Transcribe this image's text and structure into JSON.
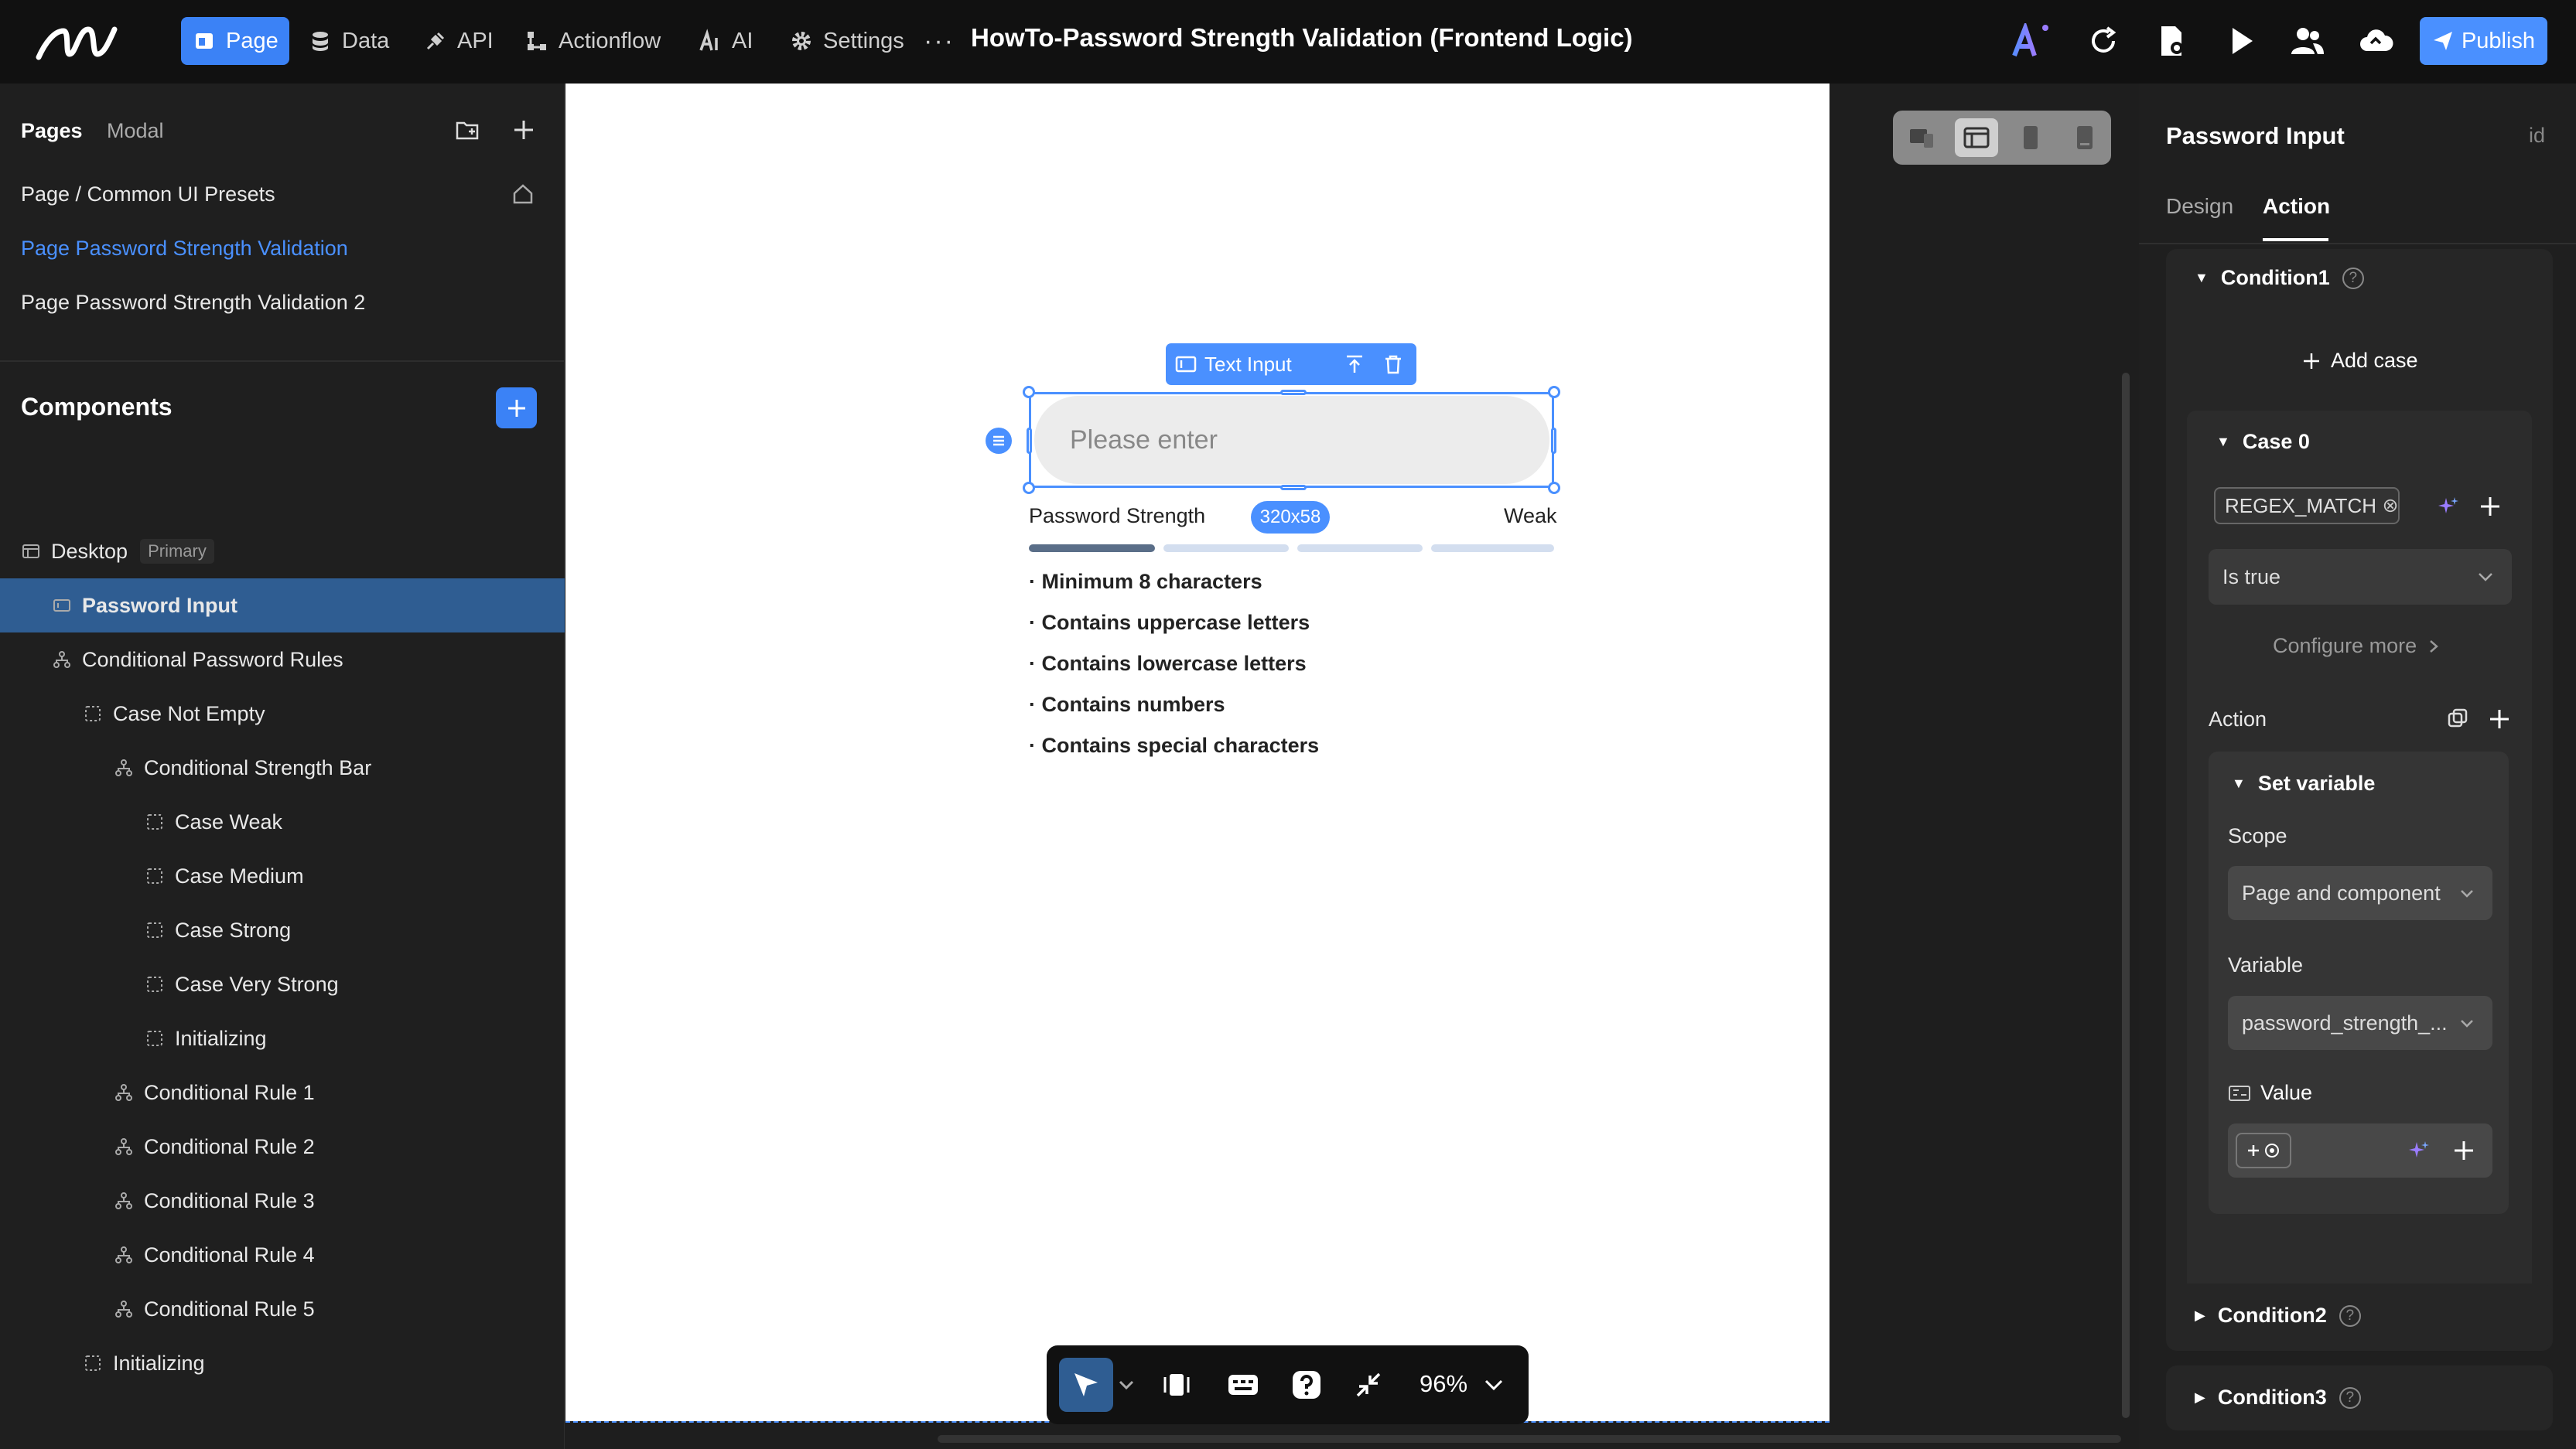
{
  "topbar": {
    "nav": [
      {
        "label": "Page",
        "icon": "page-icon"
      },
      {
        "label": "Data",
        "icon": "database-icon"
      },
      {
        "label": "API",
        "icon": "plug-icon"
      },
      {
        "label": "Actionflow",
        "icon": "flow-icon"
      },
      {
        "label": "AI",
        "icon": "ai-icon"
      },
      {
        "label": "Settings",
        "icon": "gear-icon"
      }
    ],
    "more": "···",
    "title": "HowTo-Password Strength Validation (Frontend Logic)",
    "publish": "Publish"
  },
  "left": {
    "tabs": [
      "Pages",
      "Modal"
    ],
    "pages": [
      "Page / Common UI Presets",
      "Page Password Strength Validation",
      "Page Password Strength Validation 2"
    ],
    "components_title": "Components",
    "tree": [
      {
        "label": "Desktop",
        "badge": "Primary",
        "indent": 0,
        "icon": "frame"
      },
      {
        "label": "Password Input",
        "indent": 1,
        "icon": "input",
        "selected": true
      },
      {
        "label": "Conditional Password Rules",
        "indent": 1,
        "icon": "cond"
      },
      {
        "label": "Case Not Empty",
        "indent": 2,
        "icon": "case"
      },
      {
        "label": "Conditional Strength Bar",
        "indent": 3,
        "icon": "cond"
      },
      {
        "label": "Case Weak",
        "indent": 4,
        "icon": "case"
      },
      {
        "label": "Case Medium",
        "indent": 4,
        "icon": "case"
      },
      {
        "label": "Case Strong",
        "indent": 4,
        "icon": "case"
      },
      {
        "label": "Case Very Strong",
        "indent": 4,
        "icon": "case"
      },
      {
        "label": "Initializing",
        "indent": 4,
        "icon": "case"
      },
      {
        "label": "Conditional Rule 1",
        "indent": 3,
        "icon": "cond"
      },
      {
        "label": "Conditional Rule 2",
        "indent": 3,
        "icon": "cond"
      },
      {
        "label": "Conditional Rule 3",
        "indent": 3,
        "icon": "cond"
      },
      {
        "label": "Conditional Rule 4",
        "indent": 3,
        "icon": "cond"
      },
      {
        "label": "Conditional Rule 5",
        "indent": 3,
        "icon": "cond"
      },
      {
        "label": "Initializing",
        "indent": 2,
        "icon": "case"
      }
    ]
  },
  "canvas": {
    "toolbar_label": "Text Input",
    "placeholder": "Please enter",
    "size": "320x58",
    "strength_label": "Password Strength",
    "strength_value": "Weak",
    "rules": [
      "· Minimum 8 characters",
      "· Contains uppercase letters",
      "· Contains lowercase letters",
      "· Contains numbers",
      "· Contains special characters"
    ],
    "zoom": "96%"
  },
  "right": {
    "title": "Password Input",
    "id_label": "id",
    "tabs": [
      "Design",
      "Action"
    ],
    "condition1": "Condition1",
    "add_case": "Add case",
    "case0": "Case 0",
    "chip": "REGEX_MATCH",
    "is_true": "Is true",
    "configure_more": "Configure more",
    "action_label": "Action",
    "set_variable": "Set variable",
    "scope_label": "Scope",
    "scope_value": "Page and component",
    "variable_label": "Variable",
    "variable_value": "password_strength_...",
    "value_label": "Value",
    "condition2": "Condition2",
    "condition3": "Condition3"
  },
  "colors": {
    "accent": "#3b82f6",
    "selected_row": "#2f5d92",
    "bar_active": "#5a6e88",
    "bar_inactive": "#d3deef"
  }
}
